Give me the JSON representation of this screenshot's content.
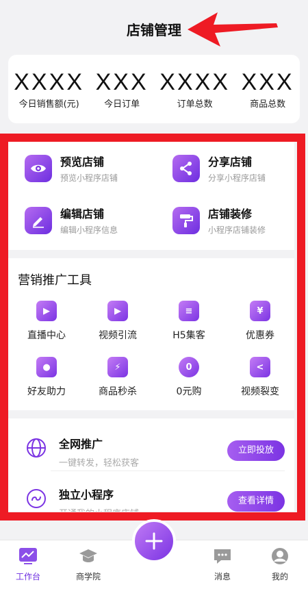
{
  "header": {
    "title": "店铺管理"
  },
  "stats": [
    {
      "value": "XXXX",
      "label": "今日销售额(元)"
    },
    {
      "value": "XXX",
      "label": "今日订单"
    },
    {
      "value": "XXXX",
      "label": "订单总数"
    },
    {
      "value": "XXX",
      "label": "商品总数"
    }
  ],
  "quick_actions": [
    {
      "title": "预览店铺",
      "subtitle": "预览小程序店铺",
      "icon": "eye-icon"
    },
    {
      "title": "分享店铺",
      "subtitle": "分享小程序店铺",
      "icon": "share-icon"
    },
    {
      "title": "编辑店铺",
      "subtitle": "编辑小程序信息",
      "icon": "edit-icon"
    },
    {
      "title": "店铺装修",
      "subtitle": "小程序店铺装修",
      "icon": "paint-roller-icon"
    }
  ],
  "marketing": {
    "title": "营销推广工具",
    "tools": [
      {
        "label": "直播中心",
        "icon": "live-icon"
      },
      {
        "label": "视频引流",
        "icon": "video-icon"
      },
      {
        "label": "H5集客",
        "icon": "h5-icon"
      },
      {
        "label": "优惠券",
        "icon": "coupon-icon"
      },
      {
        "label": "好友助力",
        "icon": "friend-icon"
      },
      {
        "label": "商品秒杀",
        "icon": "flash-sale-icon"
      },
      {
        "label": "0元购",
        "icon": "zero-buy-icon"
      },
      {
        "label": "视频裂变",
        "icon": "video-fission-icon"
      }
    ]
  },
  "promo": [
    {
      "title": "全网推广",
      "subtitle": "一键转发，轻松获客",
      "button": "立即投放",
      "icon": "globe-icon"
    },
    {
      "title": "独立小程序",
      "subtitle": "开通我的小程序店铺",
      "button": "查看详情",
      "icon": "mini-program-icon"
    }
  ],
  "tabbar": [
    {
      "label": "工作台",
      "icon": "dashboard-icon",
      "active": true
    },
    {
      "label": "商学院",
      "icon": "graduation-cap-icon",
      "active": false
    },
    {
      "label": "消息",
      "icon": "message-icon",
      "active": false
    },
    {
      "label": "我的",
      "icon": "user-icon",
      "active": false
    }
  ],
  "colors": {
    "accent": "#7b34e3",
    "annotation": "#ee1b24",
    "background": "#f2f2f4"
  }
}
